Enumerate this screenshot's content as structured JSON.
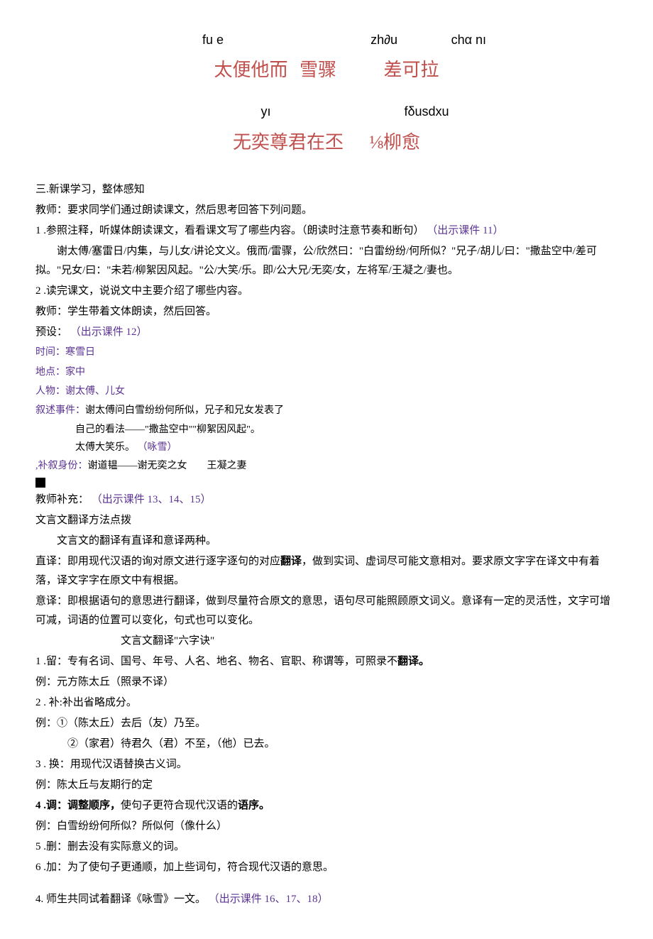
{
  "pinyin": {
    "row1_py1": "fu e",
    "row1_py2": "zh∂u",
    "row1_py3": "chα nı",
    "row1_hz1": "太便他而",
    "row1_hz2": "雪骤",
    "row1_hz3": "差可拉",
    "row2_py1": "yı",
    "row2_py2": "fδusdxu",
    "row2_hz1": "无奕尊君在丕",
    "row2_hz2": "⅛柳愈"
  },
  "sec3_title": "三.新课学习，整体感知",
  "p_teacher1": "教师：要求同学们通过朗读课文，然后思考回答下列问题。",
  "p1_num": "1 .参照注释，听媒体朗读课文，看看课文写了哪些内容。（朗读时注意节奏和断句）",
  "p1_ref": "（出示课件 11）",
  "p1_body1": "谢太傅/塞雷日/内集，与儿女/讲论文义。俄而/雷骤，公/欣然曰：\"白雷纷纷/何所似？\"兄子/胡儿/曰：\"撒盐空中/差可拟。\"兄女/曰：\"未若/柳絮因风起。\"公/大笑/乐。即/公大兄/无奕/女，左将军/王凝之/妻也。",
  "p2_num": "2 .读完课文，说说文中主要介绍了哪些内容。",
  "p_teacher2": "教师：学生带着文体朗读，然后回答。",
  "preset_label": "预设：",
  "preset_ref": "（出示课件 12）",
  "time_label": "时间：",
  "time_val": "寒雪日",
  "place_label": "地点：",
  "place_val": "家中",
  "person_label": "人物：",
  "person_val": "谢太傅、儿女",
  "event_label": "叙述事件：",
  "event_val1": "谢太傅问白雪纷纷何所似，兄子和兄女发表了",
  "event_val2": "自己的看法——\"撒盐空中\"\"柳絮因风起\"。",
  "event_val3": "太傅大笑乐。",
  "event_val3_ref": "（咏雪）",
  "supp_label": ",补叙身份：",
  "supp_val": "谢道韫——谢无奕之女　　王凝之妻",
  "teacher_supp": "教师补充：",
  "teacher_supp_ref": "（出示课件 13、14、15）",
  "trans_method_title": "文言文翻译方法点拨",
  "trans_intro": "文言文的翻译有直译和意译两种。",
  "direct_trans": "直译：即用现代汉语的询对原文进行逐字逐句的对应",
  "direct_trans_bold": "翻译",
  "direct_trans_tail": "，做到实词、虚词尽可能文意相对。要求原文字字在译文中有着落，译文字字在原文中有根据。",
  "free_trans": "意译：即根据语句的意思进行翻译，做到尽量符合原文的意思，语句尽可能照顾原文词义。意译有一定的灵活性，文字可增可减，词语的位置可以变化，句式也可以变化。",
  "six_title": "文言文翻译\"六字诀\"",
  "liu1": "1 .留：专有名词、国号、年号、人名、地名、物名、官职、称谓等，可照录不",
  "liu1_bold": "翻译。",
  "liu1_ex": "例：元方陈太丘（照录不译）",
  "liu2": "2 . 补:补出省略成分。",
  "liu2_ex1": "例：①（陈太丘）去后（友）乃至。",
  "liu2_ex2": "②（家君）待君久（君）不至，（他）已去。",
  "liu3": "3 . 换：用现代汉语替换古义词。",
  "liu3_ex": "例：陈太丘与友期行的定",
  "liu4_a": "4 .调：调整顺序，",
  "liu4_b": "使句子更符合现代汉语的",
  "liu4_c": "语序。",
  "liu4_ex": "例：白雪纷纷何所似？所似何（像什么）",
  "liu5": "5 .删：删去没有实际意义的词。",
  "liu6": "6 .加：为了使句子更通顺，加上些词句，符合现代汉语的意思。",
  "p4": "4. 师生共同试着翻译《咏雪》一文。",
  "p4_ref": "（出示课件 16、17、18）"
}
